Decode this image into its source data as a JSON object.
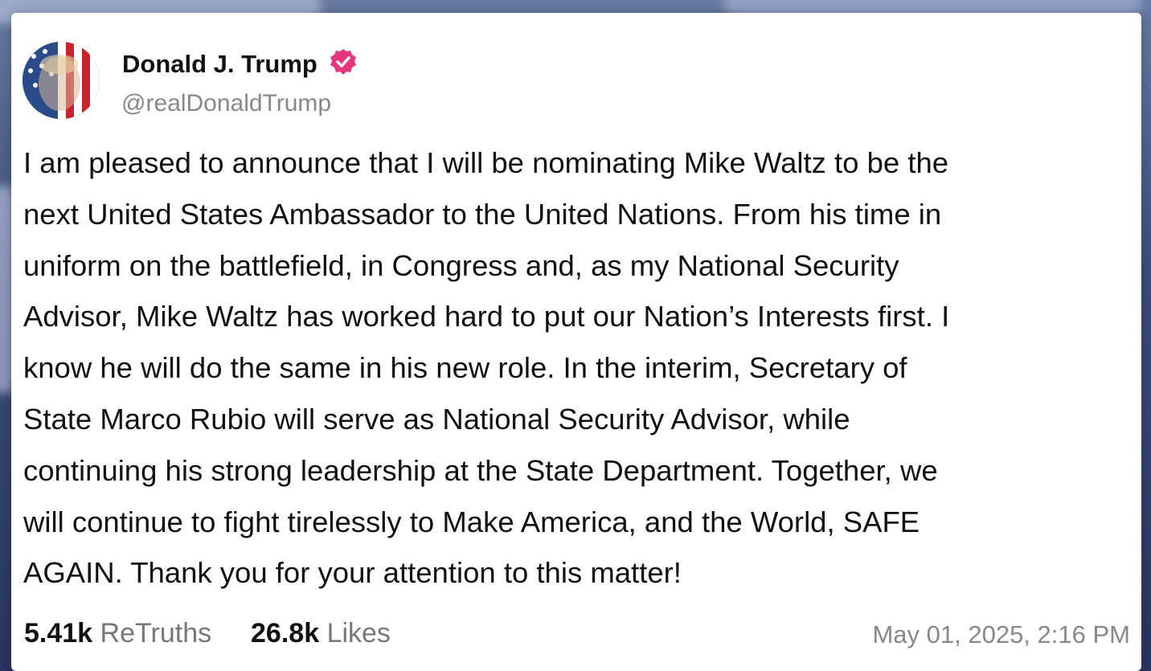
{
  "author": {
    "display_name": "Donald J. Trump",
    "handle": "@realDonaldTrump",
    "verified": true,
    "verified_badge_color": "#e5377e"
  },
  "post": {
    "lines": [
      "I am pleased to announce that I will be nominating Mike Waltz to be the",
      "next United States Ambassador to the United Nations. From his time in",
      "uniform on the battlefield, in Congress and, as my National Security",
      "Advisor, Mike Waltz has worked hard to put our Nation’s Interests first. I",
      "know he will do the same in his new role. In the interim, Secretary of",
      "State Marco Rubio will serve as National Security Advisor, while",
      "continuing his strong leadership at the State Department. Together, we",
      "will continue to fight tirelessly to Make America, and the World, SAFE",
      "AGAIN. Thank you for your attention to this matter!"
    ]
  },
  "stats": {
    "retruths_count": "5.41k",
    "retruths_label": "ReTruths",
    "likes_count": "26.8k",
    "likes_label": "Likes"
  },
  "timestamp": "May 01, 2025, 2:16 PM",
  "colors": {
    "text_primary": "#111111",
    "text_secondary": "#888888",
    "card_background": "#ffffff"
  }
}
